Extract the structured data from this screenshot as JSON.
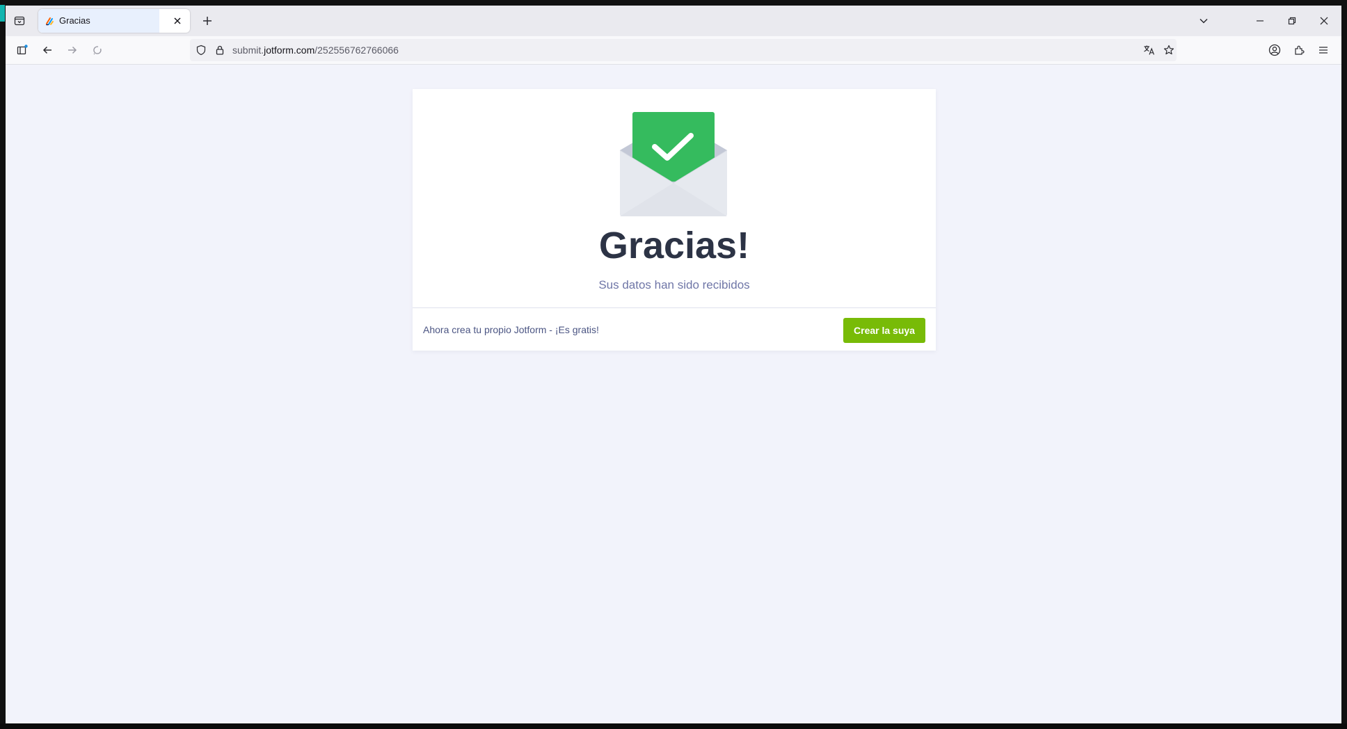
{
  "browser": {
    "tab": {
      "title": "Gracias"
    },
    "url": {
      "prefix": "submit.",
      "host": "jotform.com",
      "path": "/252556762766066"
    }
  },
  "page": {
    "title": "Gracias!",
    "subtitle": "Sus datos han sido recibidos",
    "footer_text": "Ahora crea tu propio Jotform - ¡Es gratis!",
    "cta_label": "Crear la suya"
  },
  "colors": {
    "accent_green": "#35bb5e",
    "cta_green": "#78bb07",
    "title_color": "#2c3345",
    "subtitle_color": "#6f76a7",
    "page_bg": "#f2f3fb"
  },
  "icons": {
    "tabstrip": [
      "tab-overview-icon",
      "close-icon",
      "new-tab-icon",
      "tab-list-icon",
      "minimize-icon",
      "restore-icon",
      "window-close-icon"
    ],
    "navbar": [
      "sidebar-icon",
      "back-icon",
      "forward-icon",
      "reload-icon",
      "shield-icon",
      "lock-icon",
      "translate-icon",
      "star-icon",
      "account-icon",
      "extensions-icon",
      "menu-icon"
    ]
  }
}
